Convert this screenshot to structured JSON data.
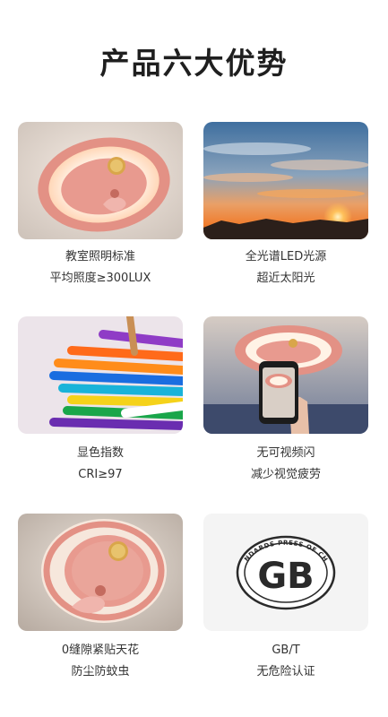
{
  "page": {
    "title": "产品六大优势"
  },
  "advantages": [
    {
      "line1": "教室照明标准",
      "line2": "平均照度≥300LUX",
      "image": "pink-ceiling-lamp-photo"
    },
    {
      "line1": "全光谱LED光源",
      "line2": "超近太阳光",
      "image": "sunset-sky-photo"
    },
    {
      "line1": "显色指数",
      "line2": "CRI≥97",
      "image": "colored-pencils-photo"
    },
    {
      "line1": "无可视频闪",
      "line2": "减少视觉疲劳",
      "image": "phone-camera-lamp-photo"
    },
    {
      "line1": "0缝隙紧贴天花",
      "line2": "防尘防蚊虫",
      "image": "lamp-side-view-photo"
    },
    {
      "line1": "GB/T",
      "line2": "无危险认证",
      "image": "gb-standards-logo"
    }
  ],
  "gb_logo": {
    "arc_text": "STANDARDS PRESS OF CHINA",
    "center_text": "GB"
  },
  "colors": {
    "lamp_pink": "#e89a8f",
    "lamp_glow": "#fff2e6",
    "sky_orange": "#f39a3c",
    "sky_blue": "#4e79a8"
  }
}
